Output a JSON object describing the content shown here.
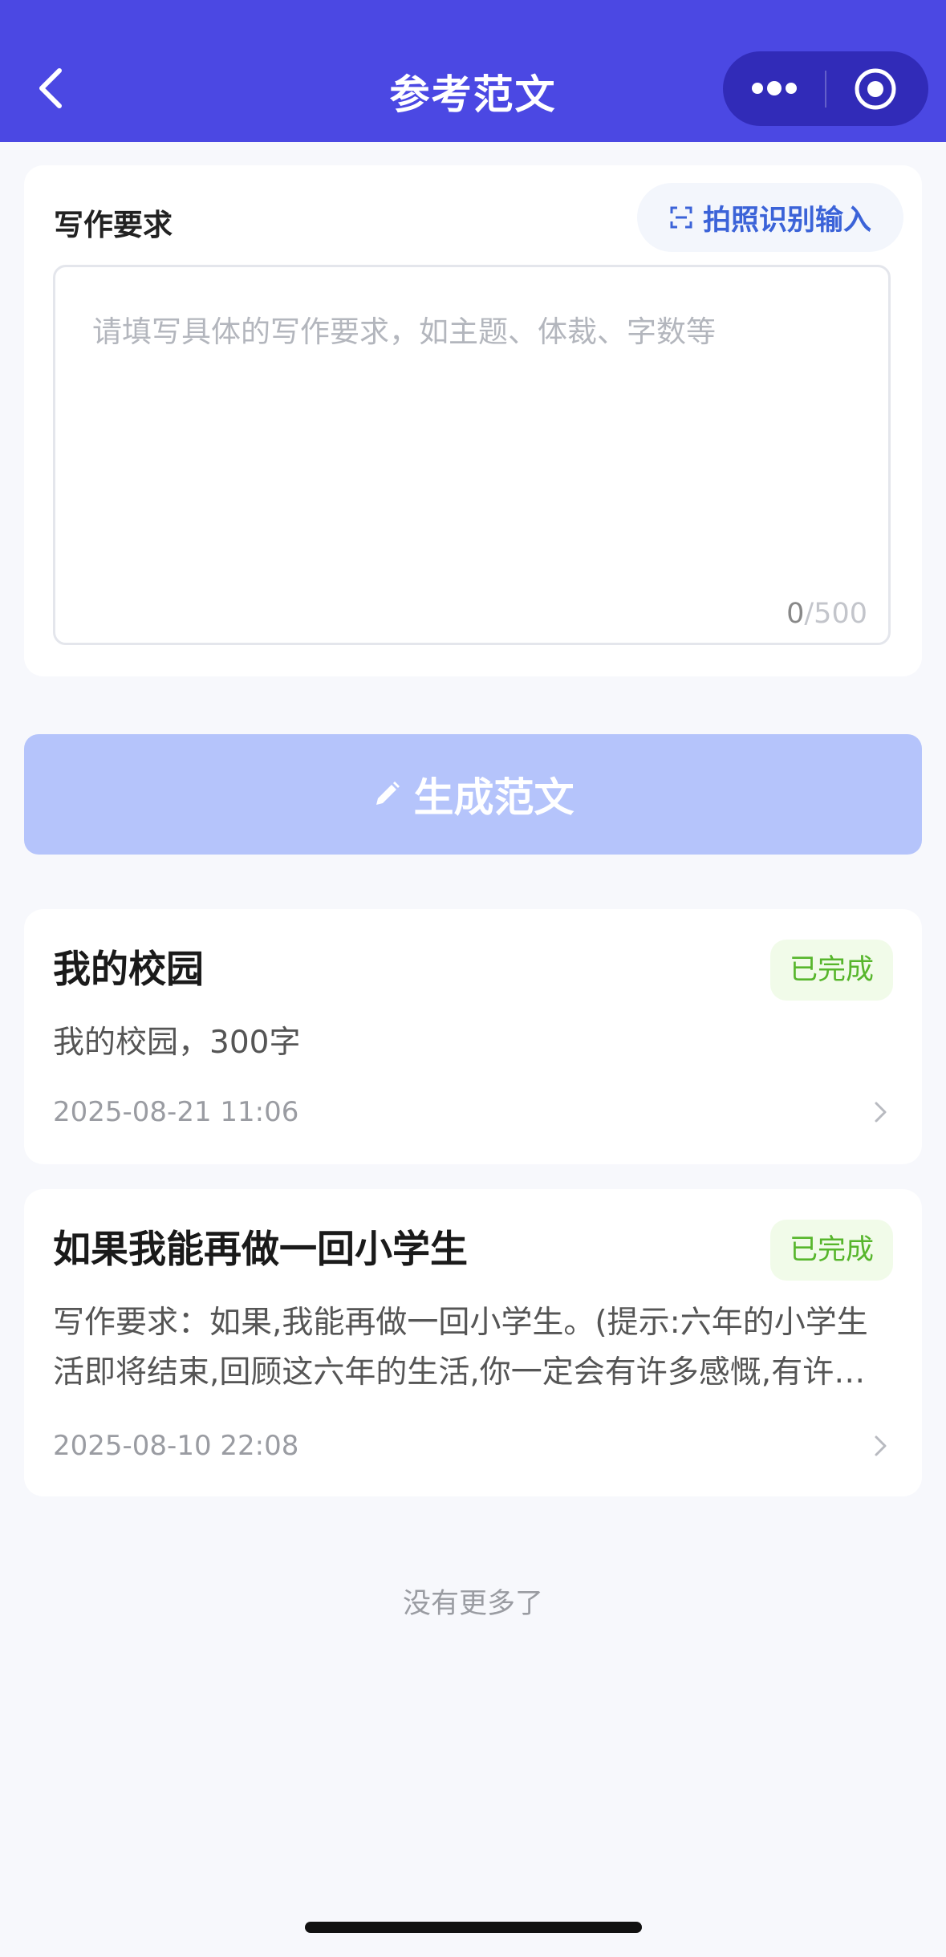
{
  "nav": {
    "title": "参考范文"
  },
  "requirements": {
    "label": "写作要求",
    "ocr_button": "拍照识别输入",
    "placeholder": "请填写具体的写作要求，如主题、体裁、字数等",
    "value": "",
    "count_current": "0",
    "count_max": "/500"
  },
  "generate_button": "生成范文",
  "history": [
    {
      "title": "我的校园",
      "status": "已完成",
      "desc": "我的校园，300字",
      "date": "2025-08-21 11:06"
    },
    {
      "title": "如果我能再做一回小学生",
      "status": "已完成",
      "desc": "写作要求：如果,我能再做一回小学生。(提示:六年的小学生活即将结束,回顾这六年的生活,你一定会有许多感慨,有许多话要说",
      "date": "2025-08-10 22:08"
    }
  ],
  "footer": {
    "no_more": "没有更多了"
  },
  "colors": {
    "primary": "#4b48e3",
    "button_disabled": "#b5c4fb",
    "success": "#57b62c",
    "link": "#3b63d8"
  }
}
